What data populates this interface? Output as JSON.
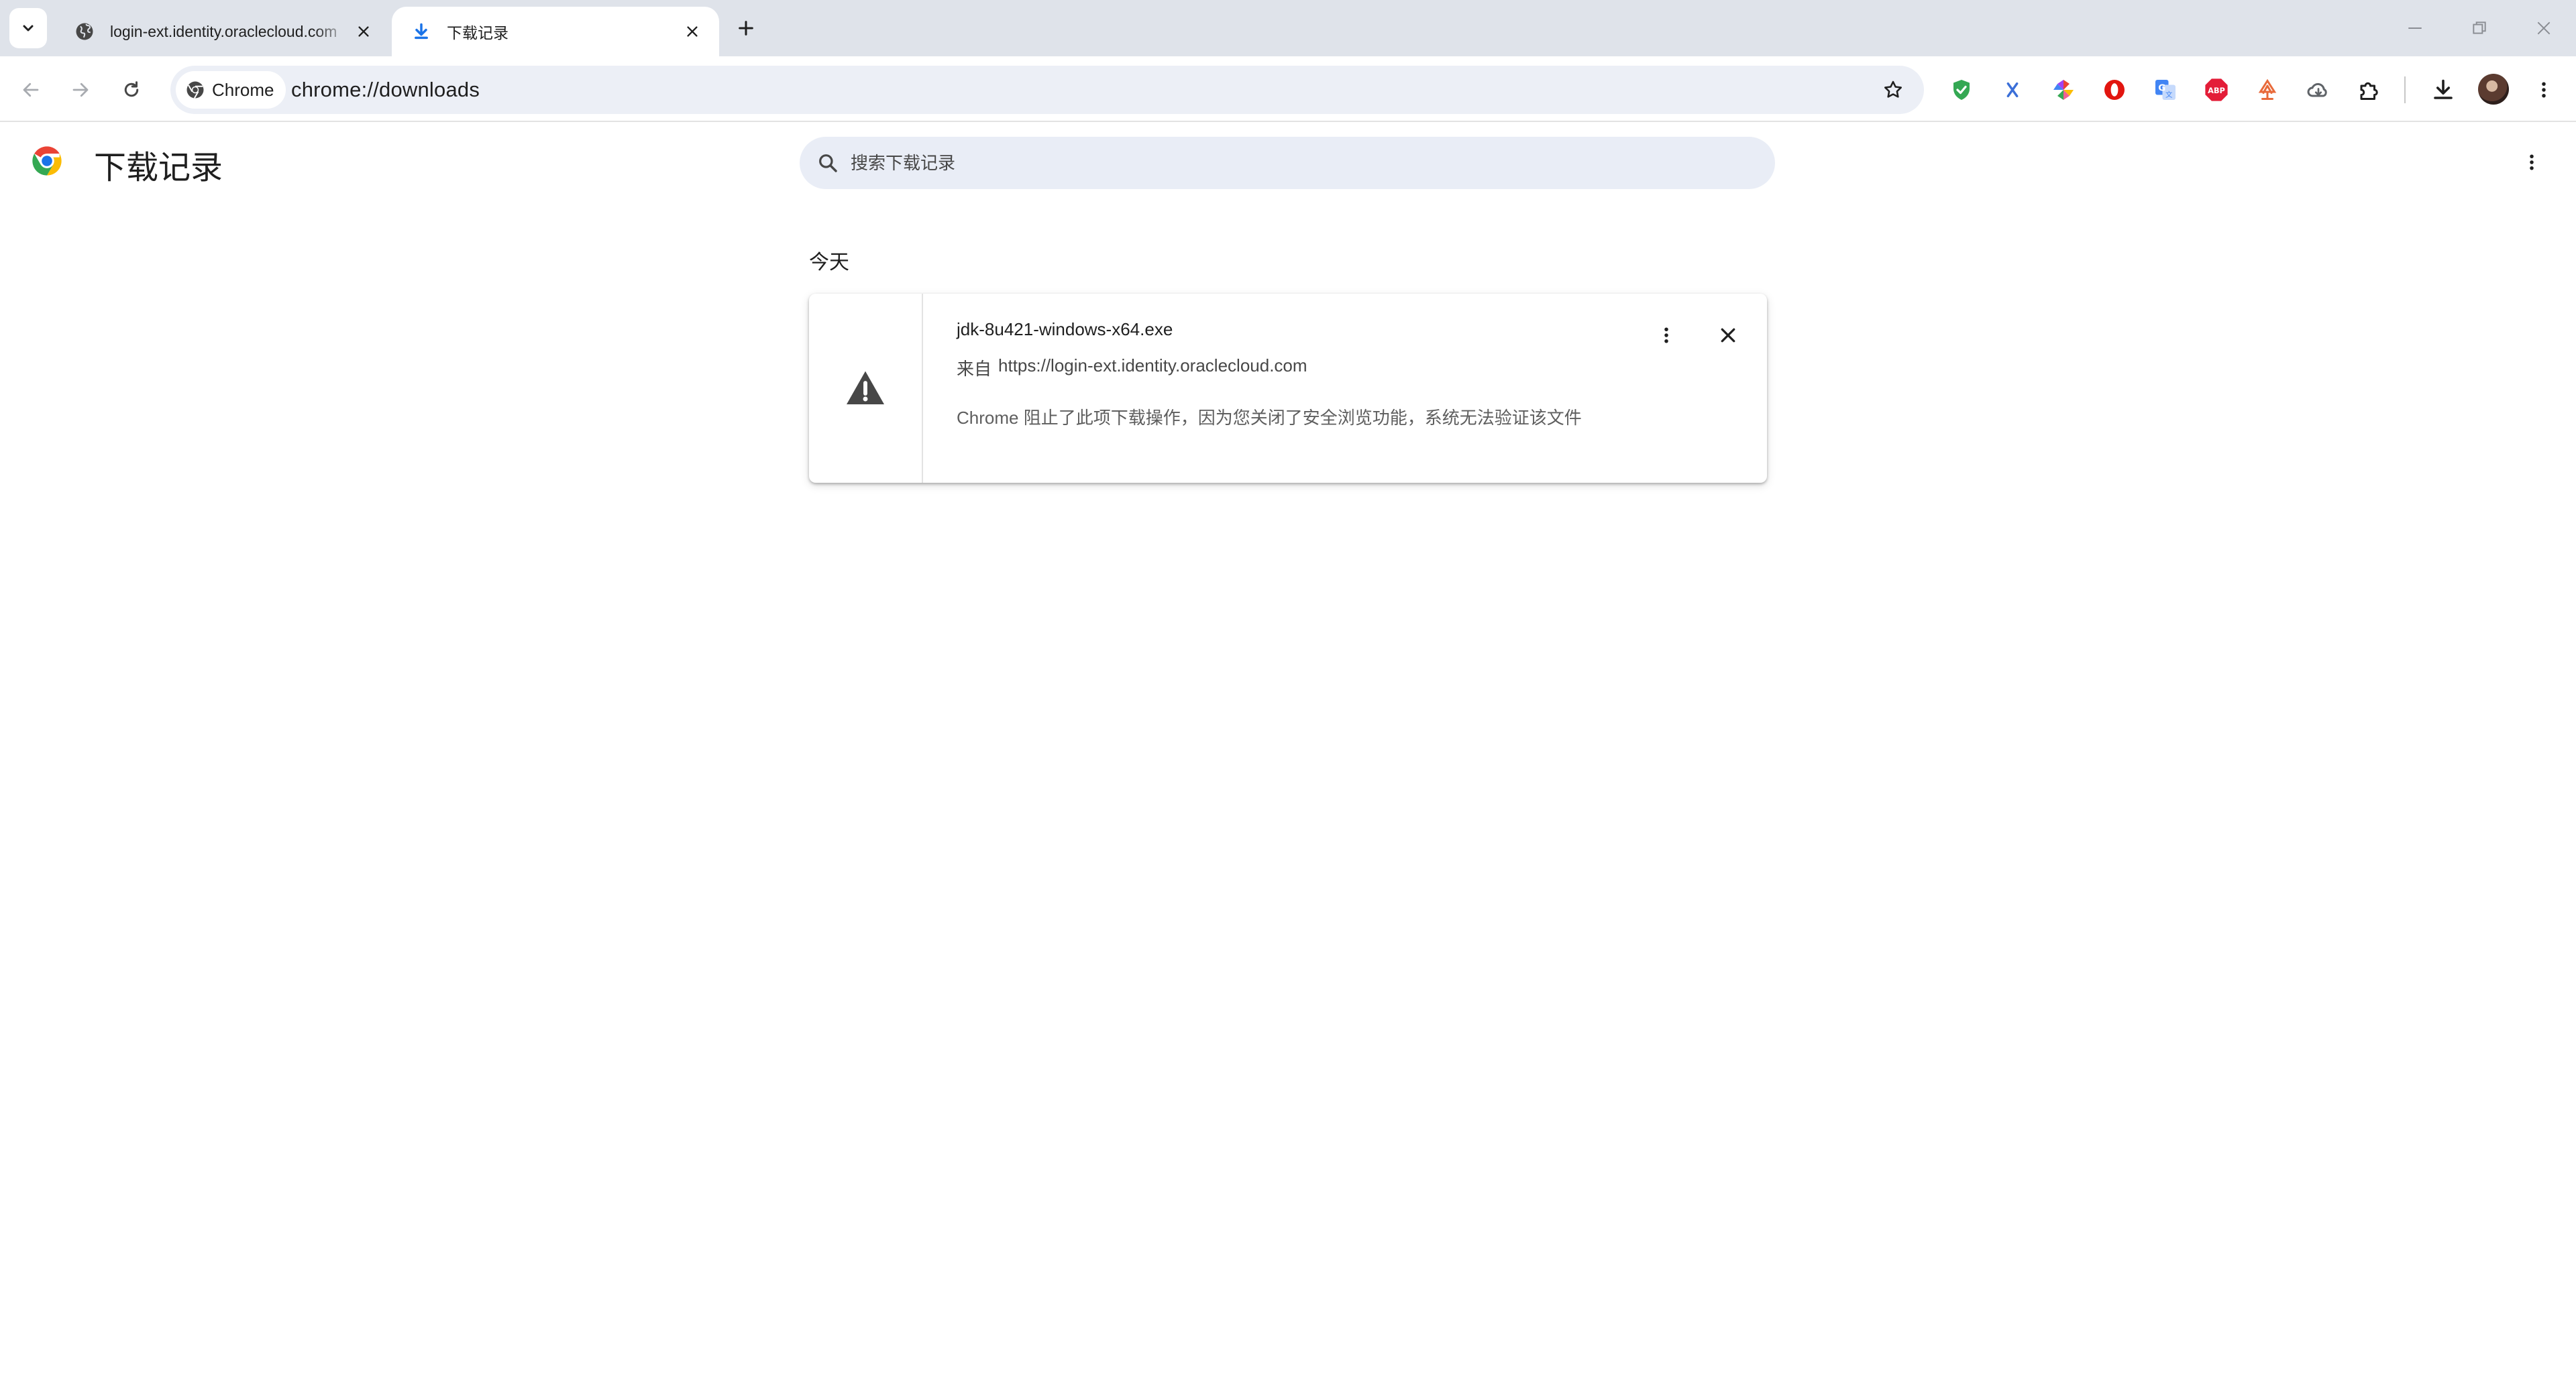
{
  "tabs": [
    {
      "title": "login-ext.identity.oraclecloud.com",
      "icon": "globe-icon",
      "active": false
    },
    {
      "title": "下载记录",
      "icon": "download-icon",
      "active": true
    }
  ],
  "toolbar": {
    "site_chip_label": "Chrome",
    "url": "chrome://downloads",
    "extensions": [
      "shield-check-icon",
      "x-extension-icon",
      "pinwheel-extension-icon",
      "opera-extension-icon",
      "translate-extension-icon",
      "adblock-plus-icon",
      "tree-extension-icon",
      "cloud-extension-icon",
      "puzzle-icon"
    ]
  },
  "page": {
    "title": "下载记录",
    "search_placeholder": "搜索下载记录",
    "date_group": "今天"
  },
  "download": {
    "file_name": "jdk-8u421-windows-x64.exe",
    "source_prefix": "来自",
    "source_url": "https://login-ext.identity.oraclecloud.com",
    "warning": "Chrome 阻止了此项下载操作，因为您关闭了安全浏览功能，系统无法验证该文件"
  },
  "colors": {
    "tabstrip_bg": "#dfe3ea",
    "omnibox_bg": "#eceff6",
    "download_tab_icon": "#1a73e8",
    "warning_icon": "#474747"
  }
}
